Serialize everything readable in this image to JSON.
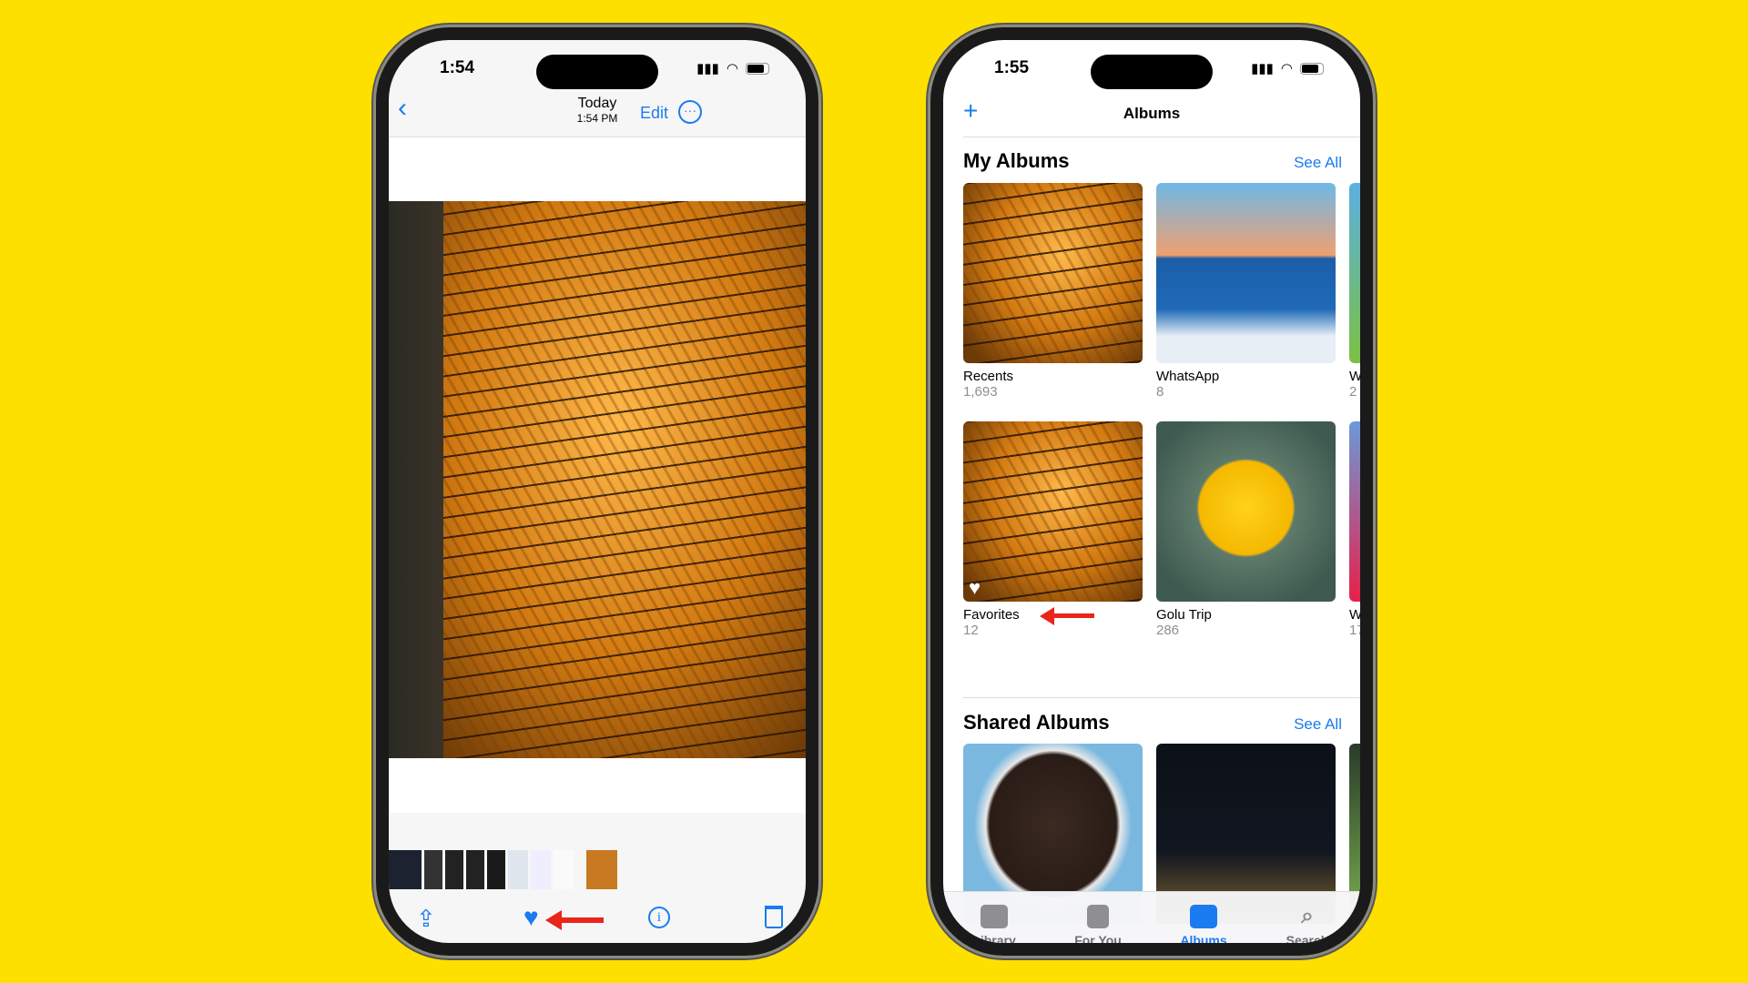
{
  "left_phone": {
    "status": {
      "time": "1:54"
    },
    "nav": {
      "title": "Today",
      "subtitle": "1:54 PM",
      "edit": "Edit"
    },
    "toolbar": {
      "icons": [
        "share-icon",
        "heart-filled-icon",
        "info-icon",
        "trash-icon"
      ]
    }
  },
  "right_phone": {
    "status": {
      "time": "1:55"
    },
    "nav": {
      "title": "Albums"
    },
    "my_albums": {
      "title": "My Albums",
      "see_all": "See All",
      "albums": [
        {
          "name": "Recents",
          "count": "1,693"
        },
        {
          "name": "WhatsApp",
          "count": "8"
        },
        {
          "name": "W",
          "count": "2"
        },
        {
          "name": "Favorites",
          "count": "12"
        },
        {
          "name": "Golu Trip",
          "count": "286"
        },
        {
          "name": "W",
          "count": "17"
        }
      ]
    },
    "shared_albums": {
      "title": "Shared Albums",
      "see_all": "See All"
    },
    "tabs": [
      {
        "label": "Library"
      },
      {
        "label": "For You"
      },
      {
        "label": "Albums",
        "active": true
      },
      {
        "label": "Search"
      }
    ]
  },
  "colors": {
    "background": "#fde000",
    "accent": "#1a7cf0",
    "annotation_arrow": "#e8261a"
  }
}
